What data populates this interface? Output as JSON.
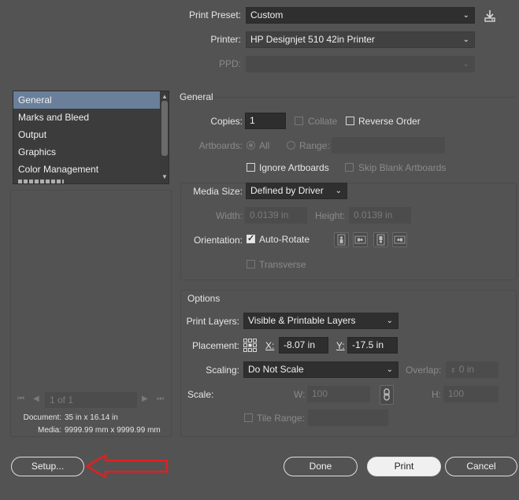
{
  "top": {
    "print_preset_label": "Print Preset:",
    "print_preset_value": "Custom",
    "printer_label": "Printer:",
    "printer_value": "HP Designjet 510 42in Printer",
    "ppd_label": "PPD:"
  },
  "sidebar": {
    "items": [
      {
        "label": "General"
      },
      {
        "label": "Marks and Bleed"
      },
      {
        "label": "Output"
      },
      {
        "label": "Graphics"
      },
      {
        "label": "Color Management"
      }
    ],
    "page_nav": "1 of 1",
    "document_label": "Document:",
    "document_value": "35 in x 16.14 in",
    "media_label": "Media:",
    "media_value": "9999.99 mm x 9999.99 mm"
  },
  "general": {
    "section_title": "General",
    "copies_label": "Copies:",
    "copies_value": "1",
    "collate_label": "Collate",
    "reverse_order_label": "Reverse Order",
    "artboards_label": "Artboards:",
    "all_label": "All",
    "range_label": "Range:",
    "ignore_artboards_label": "Ignore Artboards",
    "skip_blank_label": "Skip Blank Artboards",
    "media_size_label": "Media Size:",
    "media_size_value": "Defined by Driver",
    "width_label": "Width:",
    "width_value": "0.0139 in",
    "height_label": "Height:",
    "height_value": "0.0139 in",
    "orientation_label": "Orientation:",
    "auto_rotate_label": "Auto-Rotate",
    "transverse_label": "Transverse"
  },
  "options": {
    "section_title": "Options",
    "print_layers_label": "Print Layers:",
    "print_layers_value": "Visible & Printable Layers",
    "placement_label": "Placement:",
    "x_label": "X:",
    "x_value": "-8.07 in",
    "y_label": "Y:",
    "y_value": "-17.5 in",
    "scaling_label": "Scaling:",
    "scaling_value": "Do Not Scale",
    "overlap_label": "Overlap:",
    "overlap_value": "0 in",
    "scale_label": "Scale:",
    "w_label": "W:",
    "w_value": "100",
    "h_label": "H:",
    "h_value": "100",
    "tile_range_label": "Tile Range:"
  },
  "buttons": {
    "setup": "Setup...",
    "done": "Done",
    "print": "Print",
    "cancel": "Cancel"
  },
  "colors": {
    "background": "#535353",
    "selection": "#6a7f9a",
    "annotation_arrow": "#e02020"
  }
}
